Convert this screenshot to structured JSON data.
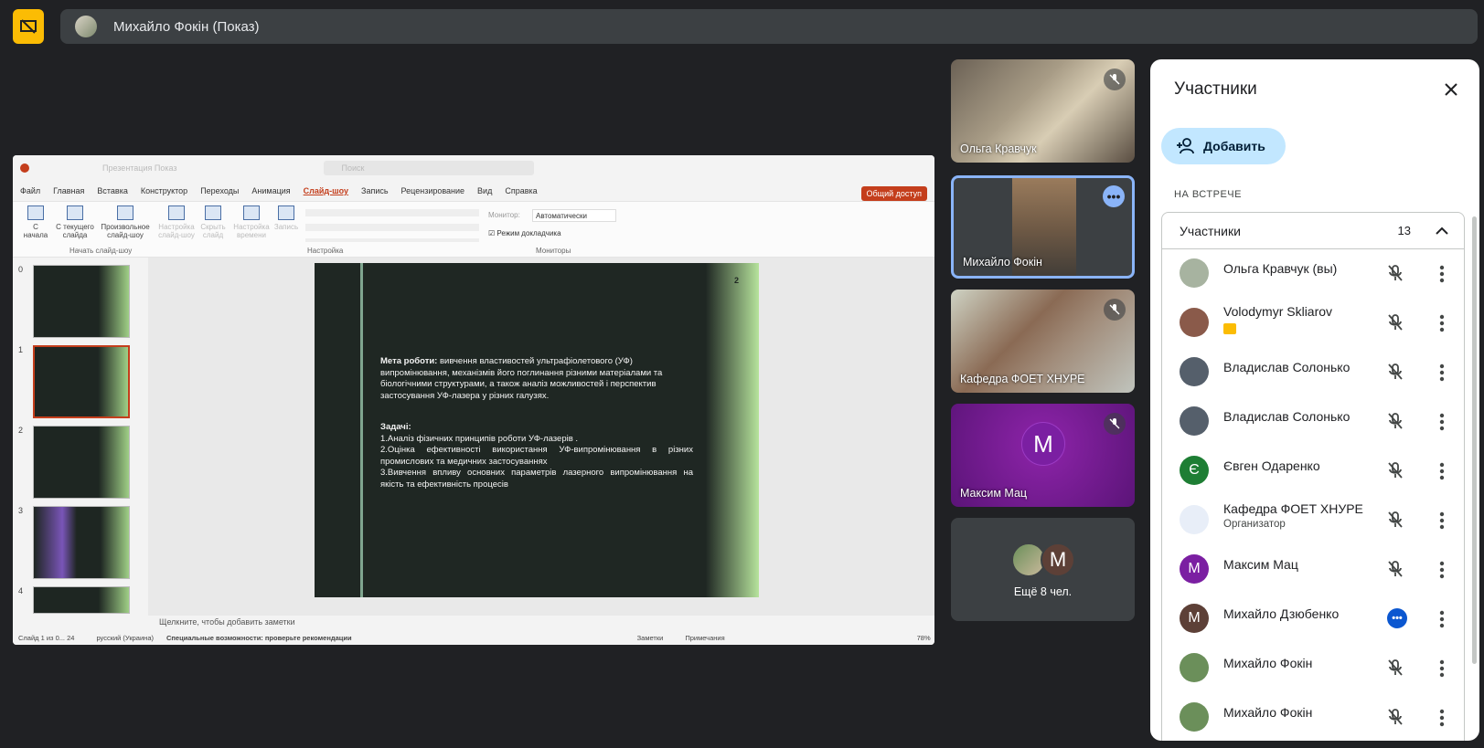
{
  "presenting": {
    "label": "Михайло Фокін (Показ)"
  },
  "shared_screen": {
    "title_bar": "Презентация Показ",
    "search_placeholder": "Поиск",
    "menu": [
      "Файл",
      "Главная",
      "Вставка",
      "Конструктор",
      "Переходы",
      "Анимация",
      "Слайд-шоу",
      "Запись",
      "Рецензирование",
      "Вид",
      "Справка"
    ],
    "active_menu": "Слайд-шоу",
    "share_button": "Общий доступ",
    "ribbon": {
      "from_start": "С начала",
      "from_current": "С текущего слайда",
      "custom_show": "Произвольное слайд-шоу",
      "setup": "Настройка слайд-шоу",
      "hide_slide": "Скрыть слайд",
      "rehearse": "Настройка времени",
      "record": "Запись",
      "group_start": "Начать слайд-шоу",
      "group_setup": "Настройка",
      "group_monitors": "Мониторы",
      "monitor_label": "Монитор:",
      "monitor_value": "Автоматически",
      "presenter_view": "Режим докладчика"
    },
    "thumb_numbers": [
      "0",
      "1",
      "2",
      "3",
      "4"
    ],
    "slide": {
      "number": "2",
      "goal_label": "Мета роботи:",
      "goal_text": "вивчення властивостей ультрафіолетового (УФ) випромінювання, механізмів його поглинання різними матеріалами та біологічними структурами, а також аналіз можливостей і перспектив застосування УФ-лазера у різних галузях.",
      "tasks_label": "Задачі:",
      "task1": "1.Аналіз фізичних принципів роботи УФ-лазерів .",
      "task2": "2.Оцінка ефективності використання УФ-випромінювання в різних промислових та медичних застосуваннях",
      "task3": "3.Вивчення впливу основних параметрів лазерного випромінювання на якість та ефективність процесів"
    },
    "notes_placeholder": "Щелкните, чтобы добавить заметки",
    "status": {
      "slide_counter": "Слайд 1 из 0... 24",
      "language": "русский (Украина)",
      "accessibility": "Специальные возможности: проверьте рекомендации",
      "notes": "Заметки",
      "comments": "Примечания",
      "zoom": "78%"
    }
  },
  "tiles": [
    {
      "name": "Ольга Кравчук"
    },
    {
      "name": "Михайло Фокін"
    },
    {
      "name": "Кафедра ФОЕТ ХНУРЕ"
    },
    {
      "name": "Максим Мац",
      "initial": "M"
    },
    {
      "name": "Ещё 8 чел.",
      "initial": "M"
    }
  ],
  "panel": {
    "title": "Участники",
    "add_button": "Добавить",
    "section_label": "НА ВСТРЕЧЕ",
    "group_title": "Участники",
    "group_count": "13",
    "participants": [
      {
        "name": "Ольга Кравчук (вы)",
        "color": "#a7b3a0"
      },
      {
        "name": "Volodymyr Skliarov",
        "color": "#8a5a4a"
      },
      {
        "name": "Владислав Солонько",
        "color": "#555f6b"
      },
      {
        "name": "Владислав Солонько",
        "color": "#555f6b"
      },
      {
        "name": "Євген Одаренко",
        "initial": "Є",
        "color": "#1e7e34"
      },
      {
        "name": "Кафедра ФОЕТ ХНУРЕ",
        "sub": "Организатор",
        "color": "#e8eef8"
      },
      {
        "name": "Максим Мац",
        "initial": "M",
        "color": "#7b1fa2"
      },
      {
        "name": "Михайло Дзюбенко",
        "initial": "M",
        "color": "#5d4037"
      },
      {
        "name": "Михайло Фокін",
        "color": "#6b8f5a"
      },
      {
        "name": "Михайло Фокін",
        "color": "#6b8f5a"
      }
    ]
  },
  "colors": {
    "background": "#202124",
    "presenting_accent": "#fbbc04",
    "add_button_bg": "#c2e7ff",
    "active_speaker_border": "#8ab4f8"
  }
}
